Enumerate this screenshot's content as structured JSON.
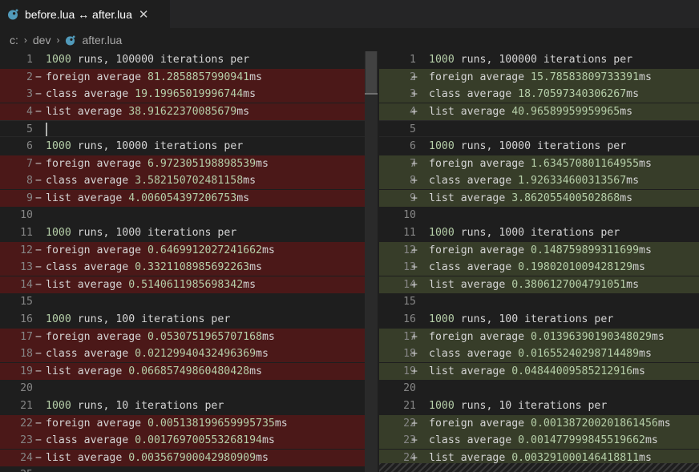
{
  "tab": {
    "title": "before.lua ↔ after.lua",
    "close_glyph": "✕",
    "icon": "lua-file-icon"
  },
  "breadcrumb": {
    "root": "c:",
    "folder": "dev",
    "file": "after.lua",
    "separator": "›"
  },
  "colors": {
    "removed_bg": "#4b1818",
    "added_bg": "#373d29",
    "accent_icon": "#519aba"
  },
  "left_lines": [
    {
      "n": "1",
      "m": "",
      "prefix": "",
      "number": "1000",
      "suffix": " runs, 100000 iterations per",
      "kind": "context"
    },
    {
      "n": "2",
      "m": "−",
      "prefix": "foreign average ",
      "number": "81.2858857990941",
      "suffix": "ms",
      "kind": "removed"
    },
    {
      "n": "3",
      "m": "−",
      "prefix": "class average ",
      "number": "19.19965019996744",
      "suffix": "ms",
      "kind": "removed"
    },
    {
      "n": "4",
      "m": "−",
      "prefix": "list average ",
      "number": "38.91622370085679",
      "suffix": "ms",
      "kind": "removed"
    },
    {
      "n": "5",
      "m": "",
      "prefix": "",
      "number": "",
      "suffix": "",
      "kind": "cursor"
    },
    {
      "n": "6",
      "m": "",
      "prefix": "",
      "number": "1000",
      "suffix": " runs, 10000 iterations per",
      "kind": "context"
    },
    {
      "n": "7",
      "m": "−",
      "prefix": "foreign average ",
      "number": "6.972305198898539",
      "suffix": "ms",
      "kind": "removed"
    },
    {
      "n": "8",
      "m": "−",
      "prefix": "class average ",
      "number": "3.582150702481158",
      "suffix": "ms",
      "kind": "removed"
    },
    {
      "n": "9",
      "m": "−",
      "prefix": "list average ",
      "number": "4.006054397206753",
      "suffix": "ms",
      "kind": "removed"
    },
    {
      "n": "10",
      "m": "",
      "prefix": "",
      "number": "",
      "suffix": "",
      "kind": "context"
    },
    {
      "n": "11",
      "m": "",
      "prefix": "",
      "number": "1000",
      "suffix": " runs, 1000 iterations per",
      "kind": "context"
    },
    {
      "n": "12",
      "m": "−",
      "prefix": "foreign average ",
      "number": "0.6469912027241662",
      "suffix": "ms",
      "kind": "removed"
    },
    {
      "n": "13",
      "m": "−",
      "prefix": "class average ",
      "number": "0.3321108985692263",
      "suffix": "ms",
      "kind": "removed"
    },
    {
      "n": "14",
      "m": "−",
      "prefix": "list average ",
      "number": "0.5140611985698342",
      "suffix": "ms",
      "kind": "removed"
    },
    {
      "n": "15",
      "m": "",
      "prefix": "",
      "number": "",
      "suffix": "",
      "kind": "context"
    },
    {
      "n": "16",
      "m": "",
      "prefix": "",
      "number": "1000",
      "suffix": " runs, 100 iterations per",
      "kind": "context"
    },
    {
      "n": "17",
      "m": "−",
      "prefix": "foreign average ",
      "number": "0.0530751965707168",
      "suffix": "ms",
      "kind": "removed"
    },
    {
      "n": "18",
      "m": "−",
      "prefix": "class average ",
      "number": "0.02129940432496369",
      "suffix": "ms",
      "kind": "removed"
    },
    {
      "n": "19",
      "m": "−",
      "prefix": "list average ",
      "number": "0.06685749860480428",
      "suffix": "ms",
      "kind": "removed"
    },
    {
      "n": "20",
      "m": "",
      "prefix": "",
      "number": "",
      "suffix": "",
      "kind": "context"
    },
    {
      "n": "21",
      "m": "",
      "prefix": "",
      "number": "1000",
      "suffix": " runs, 10 iterations per",
      "kind": "context"
    },
    {
      "n": "22",
      "m": "−",
      "prefix": "foreign average ",
      "number": "0.005138199659995735",
      "suffix": "ms",
      "kind": "removed"
    },
    {
      "n": "23",
      "m": "−",
      "prefix": "class average ",
      "number": "0.001769700553268194",
      "suffix": "ms",
      "kind": "removed"
    },
    {
      "n": "24",
      "m": "−",
      "prefix": "list average ",
      "number": "0.003567900042980909",
      "suffix": "ms",
      "kind": "removed"
    },
    {
      "n": "25",
      "m": "",
      "prefix": "",
      "number": "",
      "suffix": "",
      "kind": "context"
    }
  ],
  "right_lines": [
    {
      "n": "1",
      "m": "",
      "prefix": "",
      "number": "1000",
      "suffix": " runs, 100000 iterations per",
      "kind": "context"
    },
    {
      "n": "2",
      "m": "+",
      "prefix": "foreign average ",
      "number": "15.78583809733391",
      "suffix": "ms",
      "kind": "added"
    },
    {
      "n": "3",
      "m": "+",
      "prefix": "class average ",
      "number": "18.70597340306267",
      "suffix": "ms",
      "kind": "added"
    },
    {
      "n": "4",
      "m": "+",
      "prefix": "list average ",
      "number": "40.96589959959965",
      "suffix": "ms",
      "kind": "added"
    },
    {
      "n": "5",
      "m": "",
      "prefix": "",
      "number": "",
      "suffix": "",
      "kind": "cursor"
    },
    {
      "n": "6",
      "m": "",
      "prefix": "",
      "number": "1000",
      "suffix": " runs, 10000 iterations per",
      "kind": "context"
    },
    {
      "n": "7",
      "m": "+",
      "prefix": "foreign average ",
      "number": "1.634570801164955",
      "suffix": "ms",
      "kind": "added"
    },
    {
      "n": "8",
      "m": "+",
      "prefix": "class average ",
      "number": "1.926334600313567",
      "suffix": "ms",
      "kind": "added"
    },
    {
      "n": "9",
      "m": "+",
      "prefix": "list average ",
      "number": "3.862055400502868",
      "suffix": "ms",
      "kind": "added"
    },
    {
      "n": "10",
      "m": "",
      "prefix": "",
      "number": "",
      "suffix": "",
      "kind": "context"
    },
    {
      "n": "11",
      "m": "",
      "prefix": "",
      "number": "1000",
      "suffix": " runs, 1000 iterations per",
      "kind": "context"
    },
    {
      "n": "12",
      "m": "+",
      "prefix": "foreign average ",
      "number": "0.148759899311699",
      "suffix": "ms",
      "kind": "added"
    },
    {
      "n": "13",
      "m": "+",
      "prefix": "class average ",
      "number": "0.1980201009428129",
      "suffix": "ms",
      "kind": "added"
    },
    {
      "n": "14",
      "m": "+",
      "prefix": "list average ",
      "number": "0.3806127004791051",
      "suffix": "ms",
      "kind": "added"
    },
    {
      "n": "15",
      "m": "",
      "prefix": "",
      "number": "",
      "suffix": "",
      "kind": "context"
    },
    {
      "n": "16",
      "m": "",
      "prefix": "",
      "number": "1000",
      "suffix": " runs, 100 iterations per",
      "kind": "context"
    },
    {
      "n": "17",
      "m": "+",
      "prefix": "foreign average ",
      "number": "0.01396390190348029",
      "suffix": "ms",
      "kind": "added"
    },
    {
      "n": "18",
      "m": "+",
      "prefix": "class average ",
      "number": "0.01655240298714489",
      "suffix": "ms",
      "kind": "added"
    },
    {
      "n": "19",
      "m": "+",
      "prefix": "list average ",
      "number": "0.04844009585212916",
      "suffix": "ms",
      "kind": "added"
    },
    {
      "n": "20",
      "m": "",
      "prefix": "",
      "number": "",
      "suffix": "",
      "kind": "context"
    },
    {
      "n": "21",
      "m": "",
      "prefix": "",
      "number": "1000",
      "suffix": " runs, 10 iterations per",
      "kind": "context"
    },
    {
      "n": "22",
      "m": "+",
      "prefix": "foreign average ",
      "number": "0.001387200201861456",
      "suffix": "ms",
      "kind": "added"
    },
    {
      "n": "23",
      "m": "+",
      "prefix": "class average ",
      "number": "0.001477999845519662",
      "suffix": "ms",
      "kind": "added"
    },
    {
      "n": "24",
      "m": "+",
      "prefix": "list average ",
      "number": "0.003291000146418811",
      "suffix": "ms",
      "kind": "added"
    }
  ]
}
